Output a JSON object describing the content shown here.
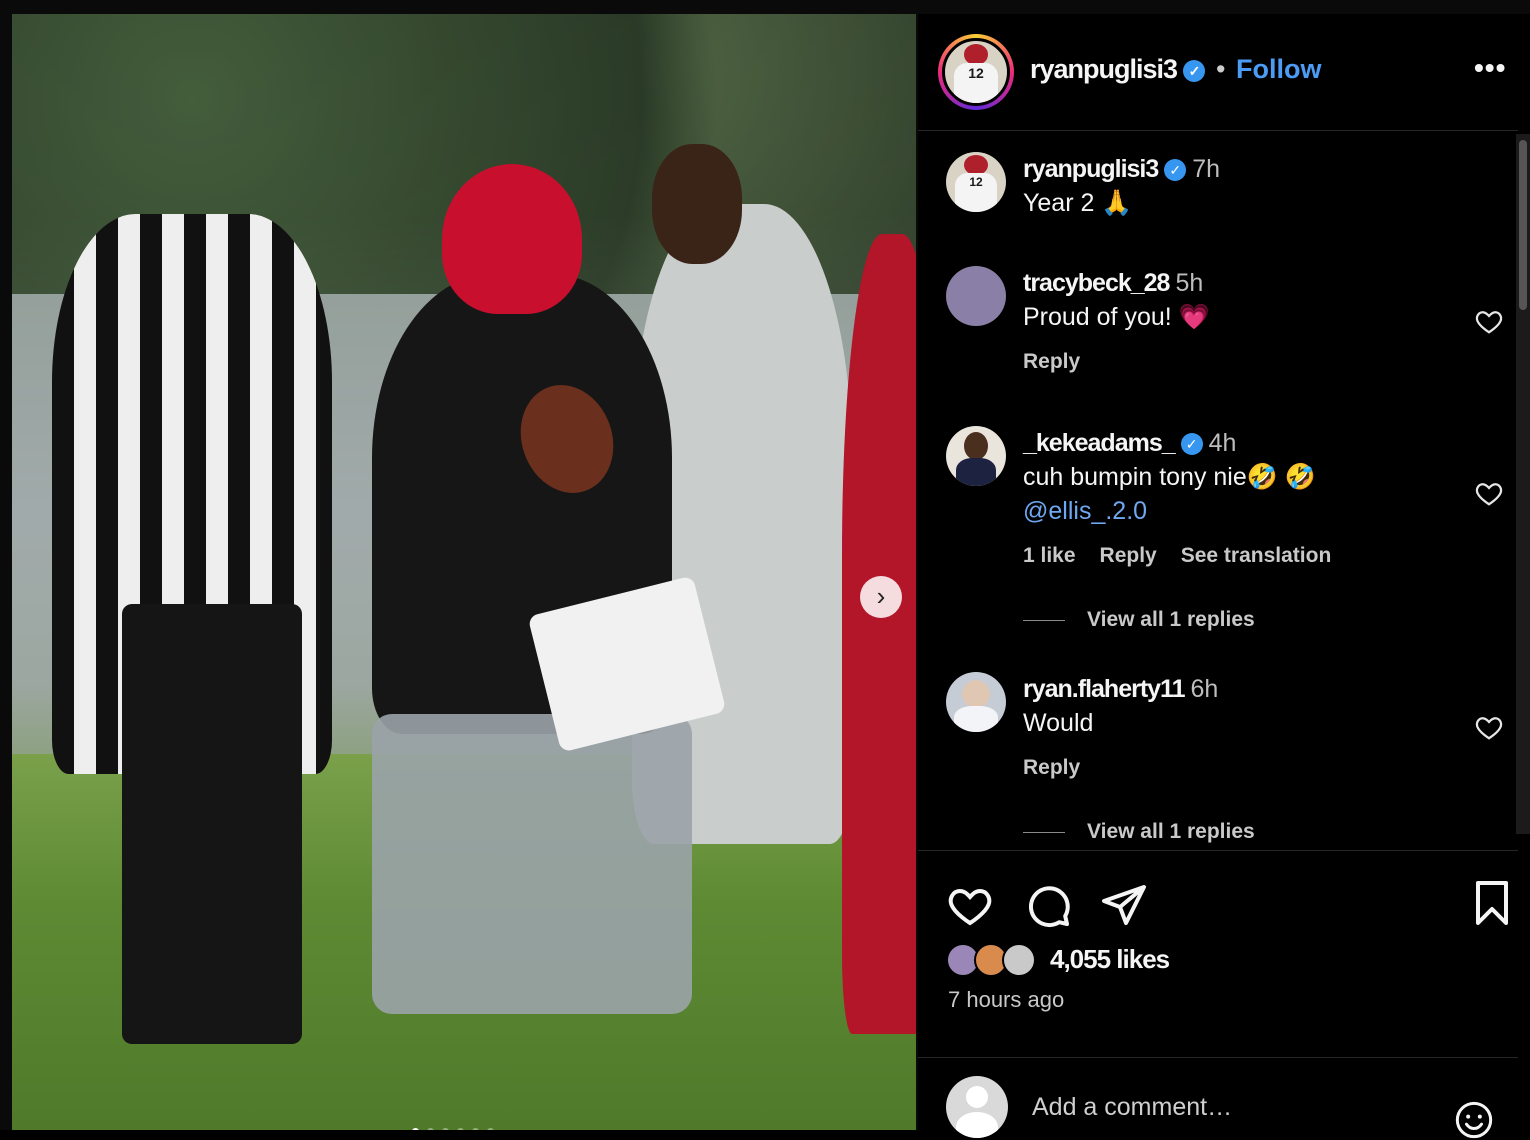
{
  "post": {
    "author": "ryanpuglisi3",
    "follow_label": "Follow",
    "separator": "•",
    "more_label": "•••",
    "jersey_number": "12",
    "carousel_next": "›"
  },
  "comments": [
    {
      "user": "ryanpuglisi3",
      "verified": true,
      "time": "7h",
      "text": "Year 2 🙏"
    },
    {
      "user": "tracybeck_28",
      "verified": false,
      "time": "5h",
      "text": "Proud of you! 💗",
      "reply_label": "Reply"
    },
    {
      "user": "_kekeadams_",
      "verified": true,
      "time": "4h",
      "text": "cuh bumpin tony nie🤣 🤣",
      "mention": "@ellis_.2.0",
      "likes_label": "1 like",
      "reply_label": "Reply",
      "translate_label": "See translation",
      "view_replies": "View all 1 replies"
    },
    {
      "user": "ryan.flaherty11",
      "verified": false,
      "time": "6h",
      "text": "Would",
      "reply_label": "Reply",
      "view_replies": "View all 1 replies"
    }
  ],
  "footer": {
    "likes": "4,055 likes",
    "time_ago": "7 hours ago",
    "comment_placeholder": "Add a comment…"
  },
  "icons": [
    "heart-icon",
    "comment-icon",
    "share-icon",
    "bookmark-icon",
    "emoji-icon",
    "verified-icon",
    "more-icon",
    "chevron-right-icon"
  ],
  "colors": {
    "follow": "#4c9bf5",
    "verified": "#3797f0",
    "mention": "#6fa8f0",
    "background": "#000000"
  }
}
